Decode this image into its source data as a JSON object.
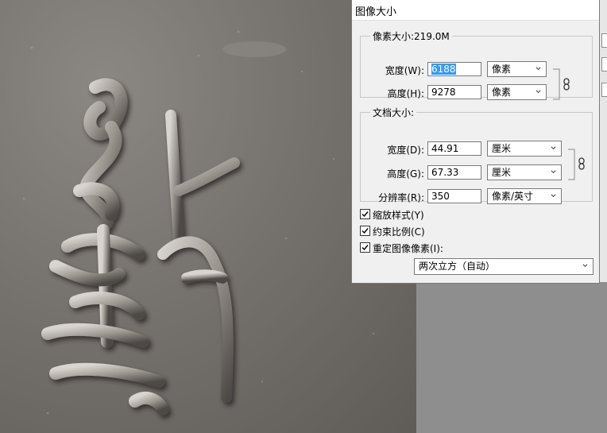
{
  "dialog": {
    "title": "图像大小",
    "pixel_dimensions": {
      "legend": "像素大小:219.0M",
      "width_label": "宽度(W):",
      "width_value": "6188",
      "width_unit": "像素",
      "height_label": "高度(H):",
      "height_value": "9278",
      "height_unit": "像素"
    },
    "document_size": {
      "legend": "文档大小:",
      "width_label": "宽度(D):",
      "width_value": "44.91",
      "width_unit": "厘米",
      "height_label": "高度(G):",
      "height_value": "67.33",
      "height_unit": "厘米",
      "resolution_label": "分辨率(R):",
      "resolution_value": "350",
      "resolution_unit": "像素/英寸"
    },
    "options": {
      "scale_styles": "缩放样式(Y)",
      "scale_styles_checked": true,
      "constrain_proportions": "约束比例(C)",
      "constrain_proportions_checked": true,
      "resample_image": "重定图像像素(I):",
      "resample_image_checked": true,
      "resample_method": "两次立方（自动）"
    }
  },
  "icons": {
    "link": "link-chain-icon",
    "chevron": "chevron-down-icon",
    "check": "checkmark-icon"
  }
}
